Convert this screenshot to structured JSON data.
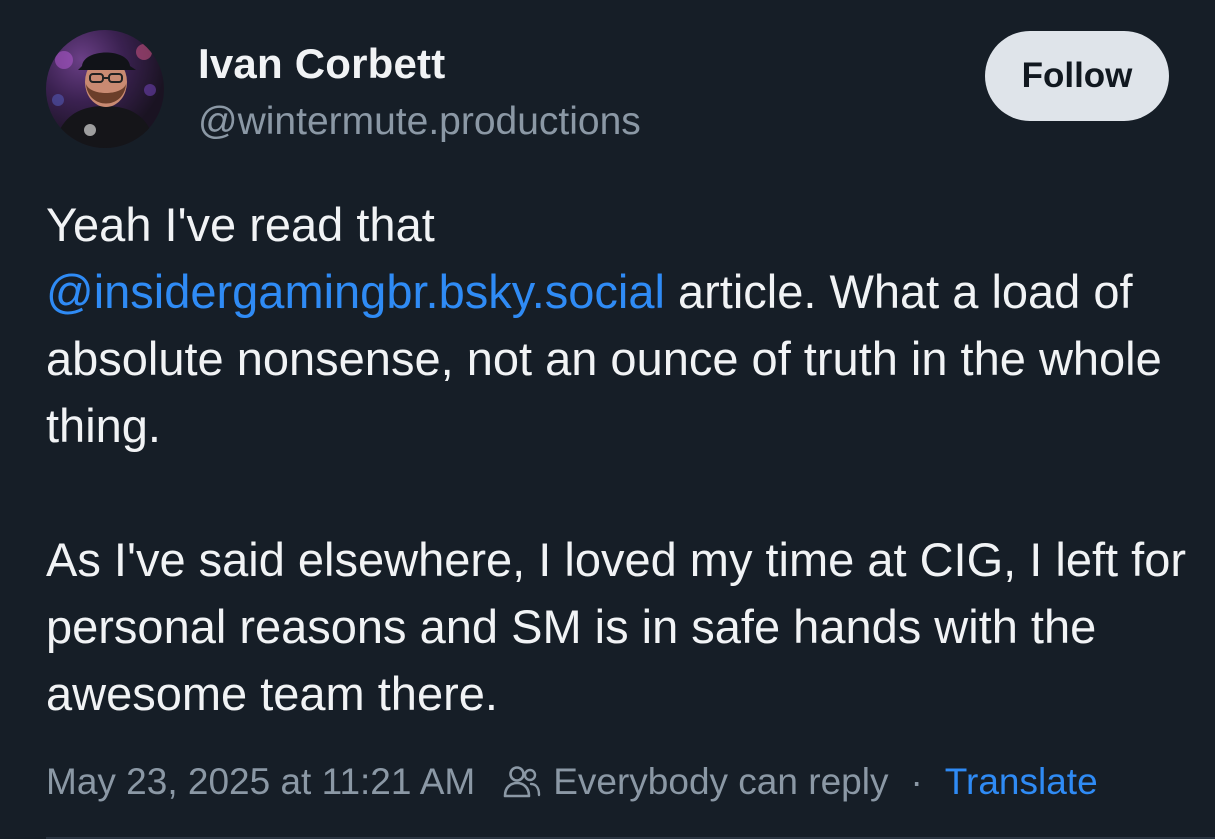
{
  "author": {
    "name": "Ivan Corbett",
    "handle": "@wintermute.productions"
  },
  "follow_button": {
    "label": "Follow"
  },
  "post": {
    "line_1": "Yeah I've read that",
    "mention": "@insidergamingbr.bsky.social",
    "after_mention": " article. What a load of absolute nonsense, not an ounce of truth in the whole thing.",
    "paragraph_2": "As I've said elsewhere, I loved my time at CIG, I left for personal reasons and SM is in safe hands with the awesome team there."
  },
  "footer": {
    "timestamp": "May 23, 2025 at 11:21 AM",
    "reply_setting": "Everybody can reply",
    "separator": "·",
    "translate_label": "Translate",
    "reply_icon": "people-icon"
  },
  "colors": {
    "background": "#161e27",
    "link": "#2f8bf5",
    "muted": "#8b98a5",
    "follow_bg": "#dfe4ea"
  }
}
